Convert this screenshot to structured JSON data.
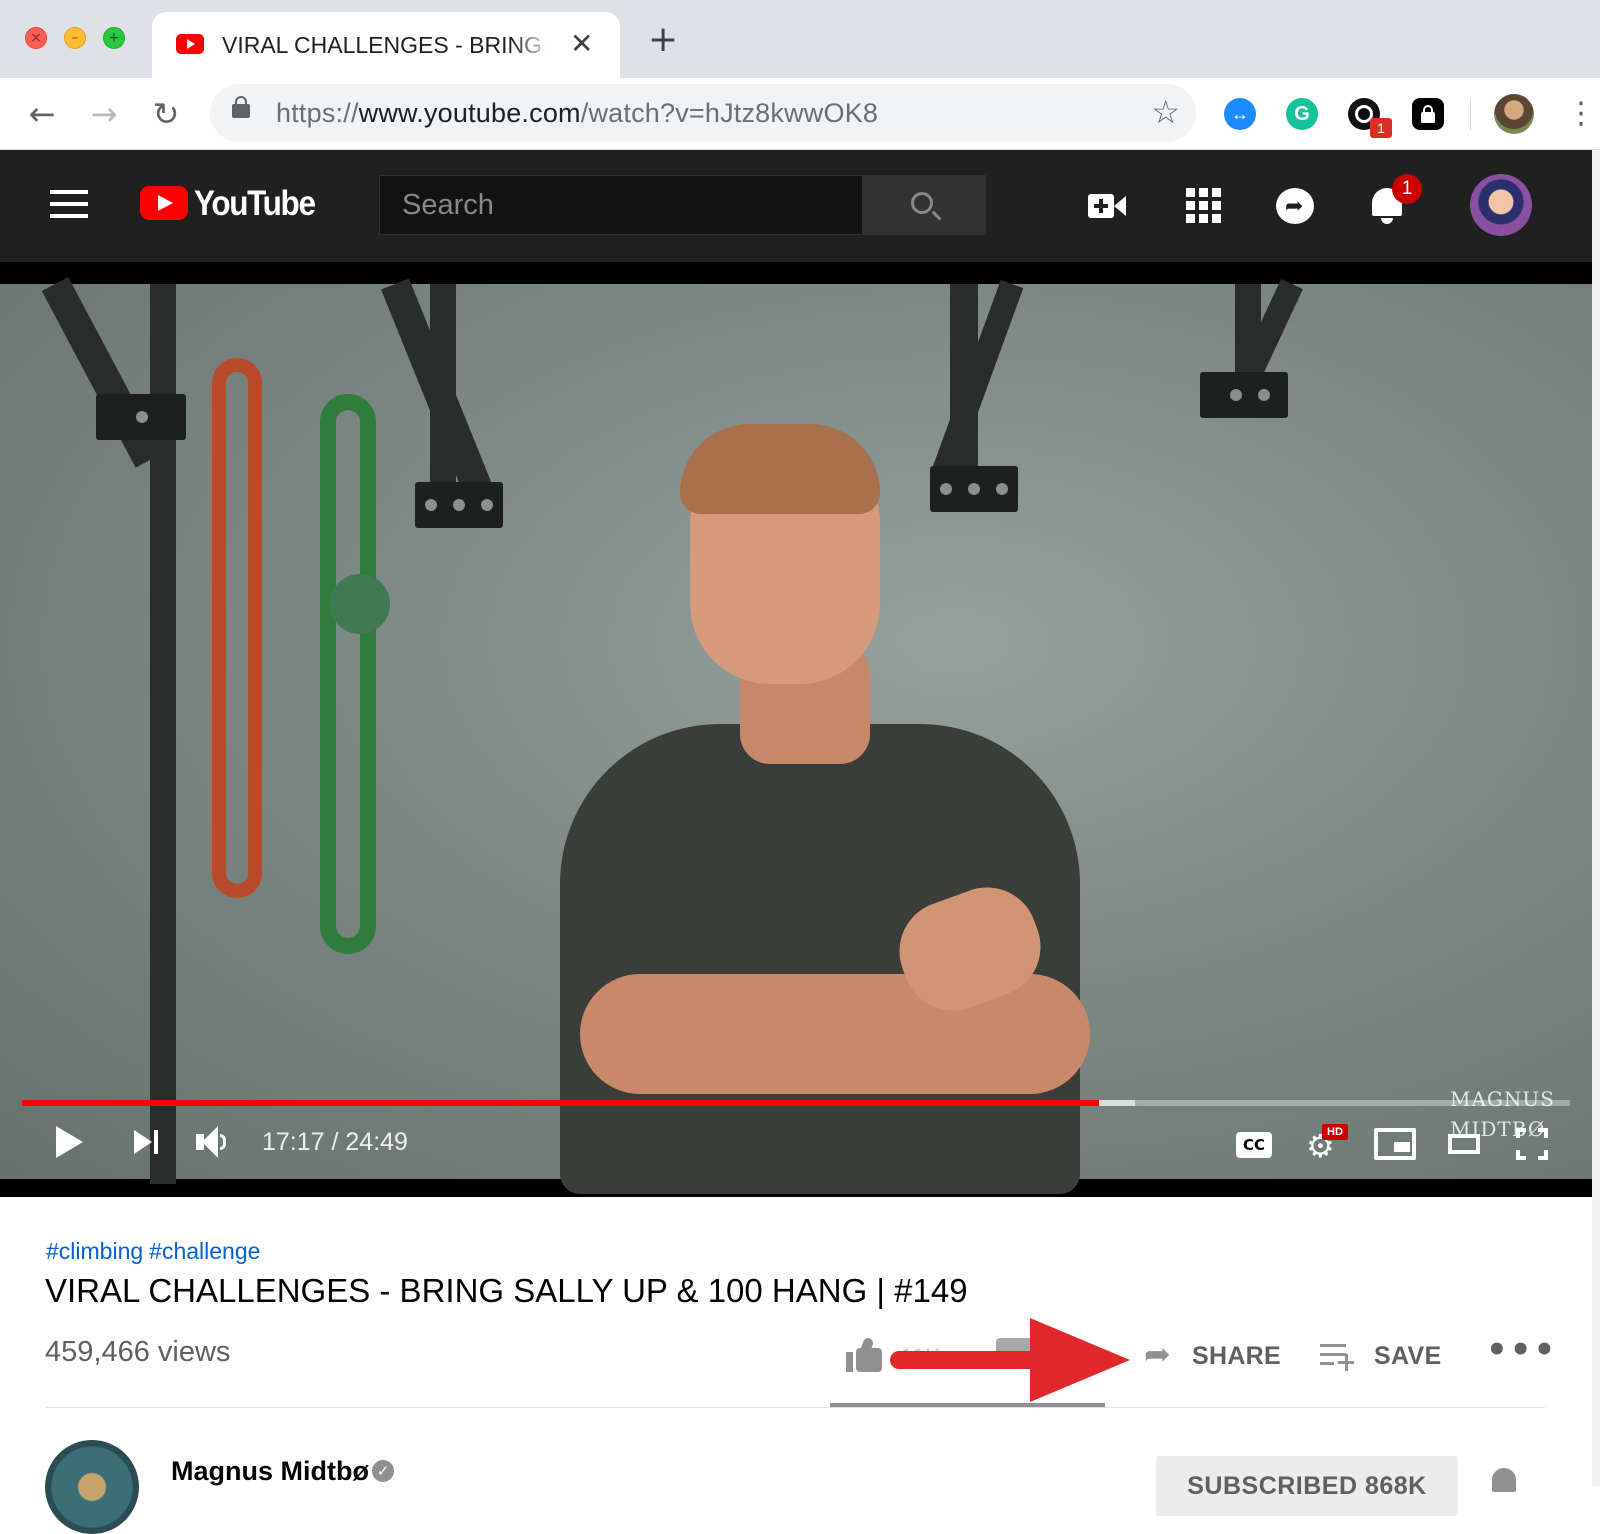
{
  "browser": {
    "tab": {
      "title": "VIRAL CHALLENGES - BRING SALLY UP & 100 HANG | #149",
      "close_glyph": "✕"
    },
    "new_tab_glyph": "+",
    "nav": {
      "back_glyph": "←",
      "forward_glyph": "→",
      "reload_glyph": "↻"
    },
    "address": {
      "scheme": "https://",
      "host": "www.youtube.com",
      "path": "/watch?v=hJtz8kwwOK8"
    },
    "star_glyph": "☆",
    "extensions": [
      {
        "icon": "link-extension-icon",
        "glyph": "↔"
      },
      {
        "icon": "grammarly-icon",
        "glyph": "G"
      },
      {
        "icon": "tracker-extension-icon",
        "badge": "1"
      },
      {
        "icon": "password-lock-icon"
      }
    ],
    "menu_glyph": "⋮"
  },
  "youtube": {
    "logo_text": "YouTube",
    "search": {
      "placeholder": "Search"
    },
    "notifications_badge": "1",
    "player": {
      "current_time": "17:17",
      "duration": "24:49",
      "time_display": "17:17 / 24:49",
      "progress_played_fraction": 0.696,
      "progress_buffered_fraction": 0.719,
      "cc_label": "CC",
      "hd_badge": "HD",
      "watermark_line1": "MAGNUS",
      "watermark_line2": "MIDTBØ"
    },
    "video": {
      "hashtags": [
        "#climbing",
        "#challenge"
      ],
      "title": "VIRAL CHALLENGES - BRING SALLY UP & 100 HANG | #149",
      "views": "459,466 views",
      "like_count": "11K",
      "share_label": "SHARE",
      "save_label": "SAVE",
      "more_glyph": "•••"
    },
    "channel": {
      "name": "Magnus Midtbø",
      "verified_glyph": "✓",
      "subscribe_label": "SUBSCRIBED 868K"
    }
  },
  "colors": {
    "youtube_red": "#ff0000",
    "masthead_bg": "#202020",
    "link_blue": "#065fd4",
    "annotation_arrow": "#e0282a"
  }
}
